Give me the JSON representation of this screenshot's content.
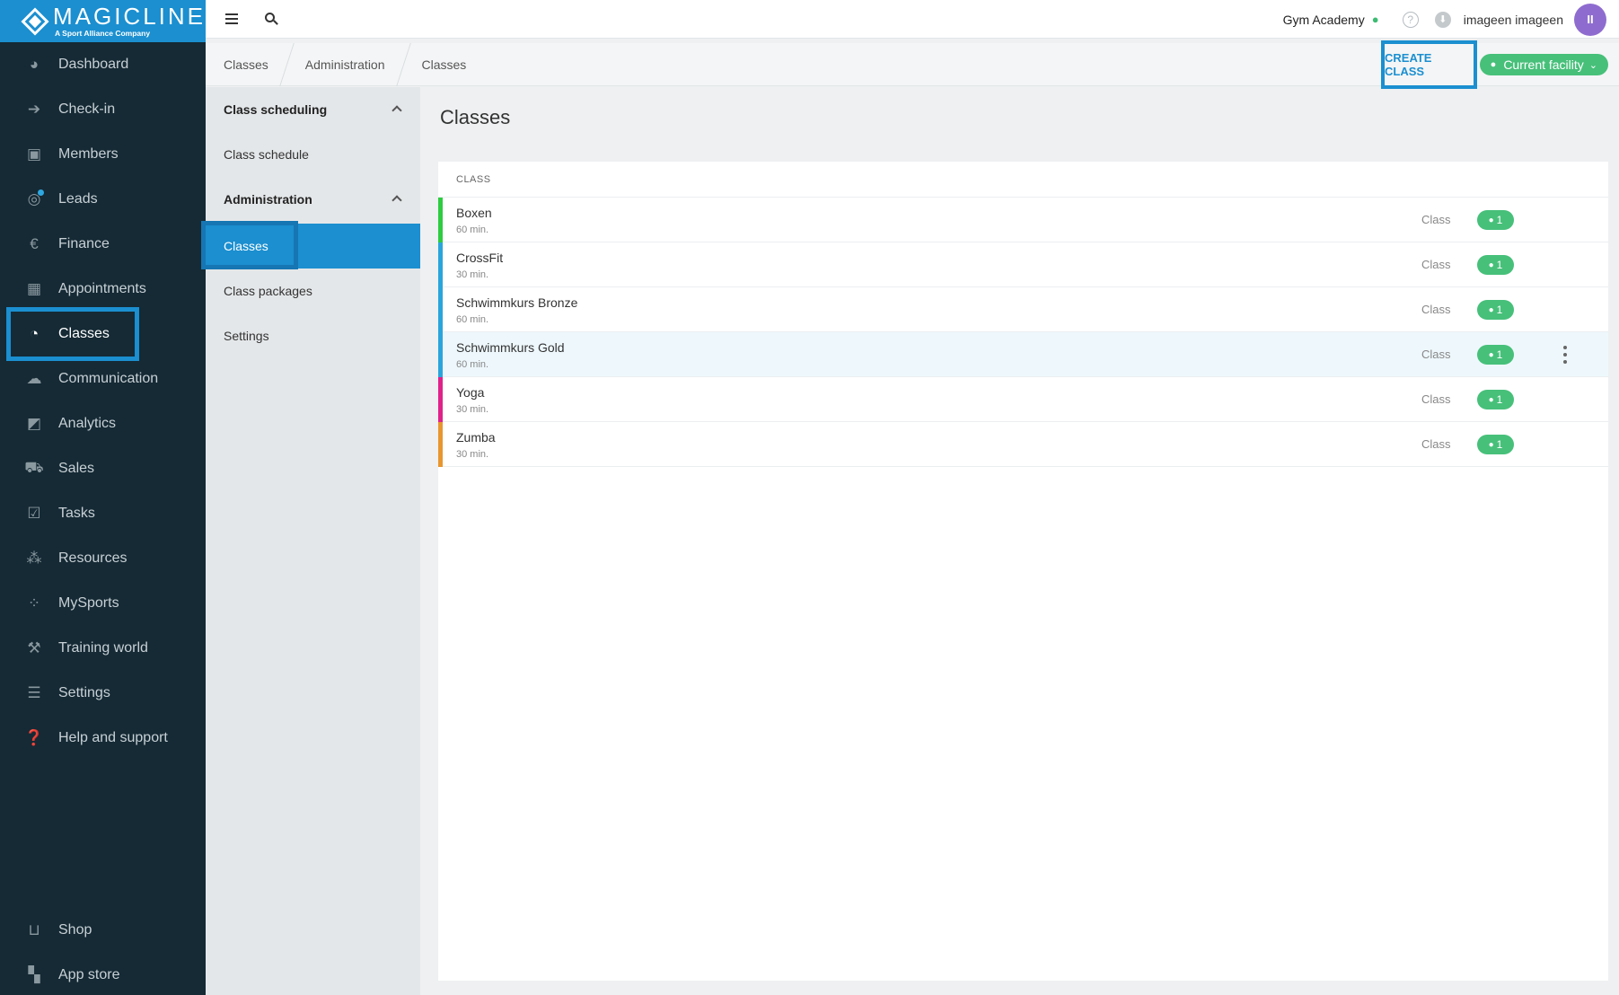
{
  "brand": {
    "name": "MAGICLINE",
    "tagline": "A Sport Alliance Company",
    "color": "#1b8fd0"
  },
  "sidebar": {
    "items": [
      {
        "label": "Dashboard",
        "icon": "dashboard-icon",
        "glyph": "◕"
      },
      {
        "label": "Check-in",
        "icon": "check-in-icon",
        "glyph": "➔"
      },
      {
        "label": "Members",
        "icon": "members-icon",
        "glyph": "▣"
      },
      {
        "label": "Leads",
        "icon": "leads-icon",
        "glyph": "◎"
      },
      {
        "label": "Finance",
        "icon": "finance-icon",
        "glyph": "€"
      },
      {
        "label": "Appointments",
        "icon": "calendar-icon",
        "glyph": "▦"
      },
      {
        "label": "Classes",
        "icon": "stopwatch-icon",
        "glyph": "◔",
        "active": true
      },
      {
        "label": "Communication",
        "icon": "chat-icon",
        "glyph": "☁"
      },
      {
        "label": "Analytics",
        "icon": "analytics-icon",
        "glyph": "◩"
      },
      {
        "label": "Sales",
        "icon": "cart-icon",
        "glyph": "⛟"
      },
      {
        "label": "Tasks",
        "icon": "tasks-icon",
        "glyph": "☑"
      },
      {
        "label": "Resources",
        "icon": "resources-icon",
        "glyph": "⁂"
      },
      {
        "label": "MySports",
        "icon": "mysports-icon",
        "glyph": "⁘"
      },
      {
        "label": "Training world",
        "icon": "dumbbell-icon",
        "glyph": "⚒"
      },
      {
        "label": "Settings",
        "icon": "sliders-icon",
        "glyph": "☰"
      },
      {
        "label": "Help and support",
        "icon": "help-icon",
        "glyph": "❓"
      }
    ],
    "bottom_items": [
      {
        "label": "Shop",
        "icon": "shop-icon",
        "glyph": "⊔"
      },
      {
        "label": "App store",
        "icon": "app-store-icon",
        "glyph": "▚"
      }
    ]
  },
  "topbar": {
    "gym_name": "Gym Academy",
    "user_name": "imageen imageen",
    "avatar_initials": "II",
    "help_glyph": "?",
    "download_glyph": "⬇"
  },
  "breadcrumb": [
    "Classes",
    "Administration",
    "Classes"
  ],
  "actions": {
    "create_label": "CREATE CLASS",
    "facility_label": "Current facility"
  },
  "subnav": {
    "sections": [
      {
        "label": "Class scheduling",
        "items": [
          "Class schedule"
        ]
      },
      {
        "label": "Administration",
        "items": [
          "Classes",
          "Class packages",
          "Settings"
        ]
      }
    ]
  },
  "page": {
    "title": "Classes",
    "column_header": "CLASS"
  },
  "classes": [
    {
      "name": "Boxen",
      "duration": "60 min.",
      "type": "Class",
      "count": "1",
      "color": "#2ecc40"
    },
    {
      "name": "CrossFit",
      "duration": "30 min.",
      "type": "Class",
      "count": "1",
      "color": "#2aa5dc"
    },
    {
      "name": "Schwimmkurs Bronze",
      "duration": "60 min.",
      "type": "Class",
      "count": "1",
      "color": "#2aa5dc"
    },
    {
      "name": "Schwimmkurs Gold",
      "duration": "60 min.",
      "type": "Class",
      "count": "1",
      "color": "#2aa5dc"
    },
    {
      "name": "Yoga",
      "duration": "30 min.",
      "type": "Class",
      "count": "1",
      "color": "#e0218a"
    },
    {
      "name": "Zumba",
      "duration": "30 min.",
      "type": "Class",
      "count": "1",
      "color": "#e8962e"
    }
  ],
  "colors": {
    "badge_green": "#47c07a",
    "sidebar_bg": "#152a35",
    "accent": "#1b8fd0"
  }
}
